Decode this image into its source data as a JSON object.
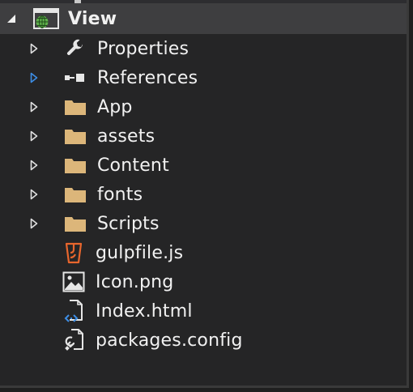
{
  "tree": {
    "root": {
      "label": "View",
      "icon": "web-project-icon",
      "expander": "expanded"
    },
    "items": [
      {
        "label": "Properties",
        "icon": "wrench-icon",
        "expander": "collapsed"
      },
      {
        "label": "References",
        "icon": "references-icon",
        "expander": "collapsed-highlight"
      },
      {
        "label": "App",
        "icon": "folder-icon",
        "expander": "collapsed"
      },
      {
        "label": "assets",
        "icon": "folder-icon",
        "expander": "collapsed"
      },
      {
        "label": "Content",
        "icon": "folder-icon",
        "expander": "collapsed"
      },
      {
        "label": "fonts",
        "icon": "folder-icon",
        "expander": "collapsed"
      },
      {
        "label": "Scripts",
        "icon": "folder-icon",
        "expander": "collapsed"
      },
      {
        "label": "gulpfile.js",
        "icon": "gulp-js-file-icon",
        "expander": "none"
      },
      {
        "label": "Icon.png",
        "icon": "image-file-icon",
        "expander": "none"
      },
      {
        "label": "Index.html",
        "icon": "html-file-icon",
        "expander": "none"
      },
      {
        "label": "packages.config",
        "icon": "config-file-icon",
        "expander": "none"
      }
    ]
  },
  "colors": {
    "background": "#252526",
    "selected_row": "#3e3e40",
    "text": "#f1f1f1",
    "folder": "#dcb67a",
    "gulp": "#e8662d",
    "highlight_arrow": "#3d8ee6"
  }
}
